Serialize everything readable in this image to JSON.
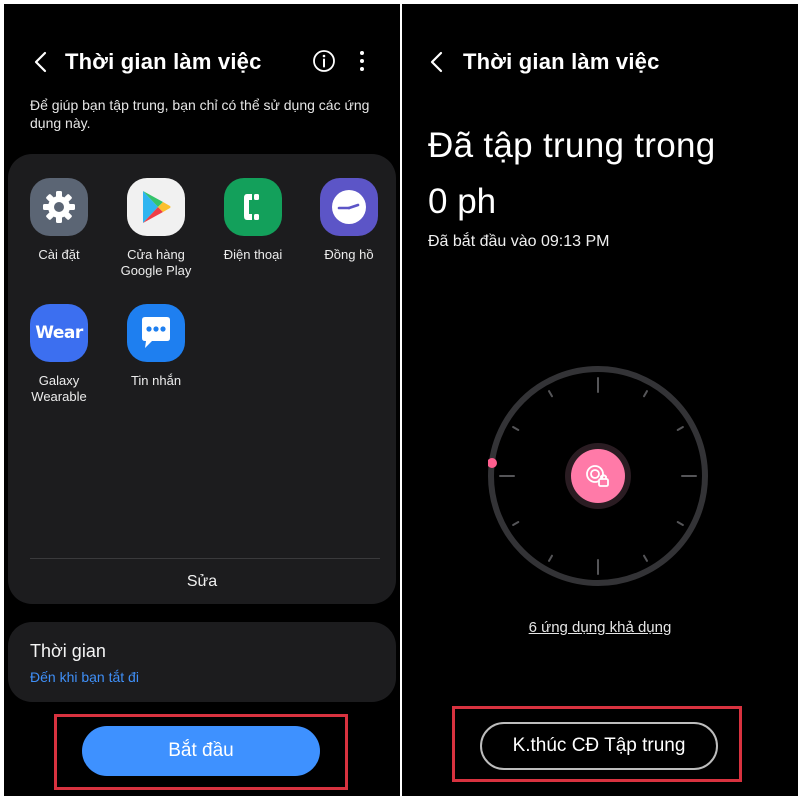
{
  "left": {
    "title": "Thời gian làm việc",
    "description": "Để giúp bạn tập trung, bạn chỉ có thể sử dụng các ứng dụng này.",
    "apps": [
      {
        "label_lines": [
          "Cài đặt"
        ],
        "icon": "gear-icon",
        "color": "#5b6574"
      },
      {
        "label_lines": [
          "Cửa hàng",
          "Google Play"
        ],
        "icon": "google-play-icon",
        "color": "#f1f1f1"
      },
      {
        "label_lines": [
          "Điện thoại"
        ],
        "icon": "phone-icon",
        "color": "#13a05b"
      },
      {
        "label_lines": [
          "Đồng hồ"
        ],
        "icon": "clock-icon",
        "color": "#5c55c7"
      },
      {
        "label_lines": [
          "Galaxy",
          "Wearable"
        ],
        "icon": "wear-icon",
        "icon_text": "Wear",
        "color": "#3c6ff0"
      },
      {
        "label_lines": [
          "Tin nhắn"
        ],
        "icon": "messages-icon",
        "color": "#1e7ff0"
      }
    ],
    "edit_label": "Sửa",
    "time": {
      "title": "Thời gian",
      "subtitle": "Đến khi bạn tắt đi"
    },
    "start_label": "Bắt đầu"
  },
  "right": {
    "title": "Thời gian làm việc",
    "focused_label": "Đã tập trung trong",
    "focused_value": "0 ph",
    "started_text": "Đã bắt đầu vào 09:13 PM",
    "apps_available": "6 ứng dụng khả dụng",
    "end_label": "K.thúc CĐ Tập trung"
  },
  "colors": {
    "accent_blue": "#3e91ff",
    "highlight_red": "#d8323f",
    "focus_pink": "#ff7aa8",
    "link_blue": "#3f8ff7"
  }
}
